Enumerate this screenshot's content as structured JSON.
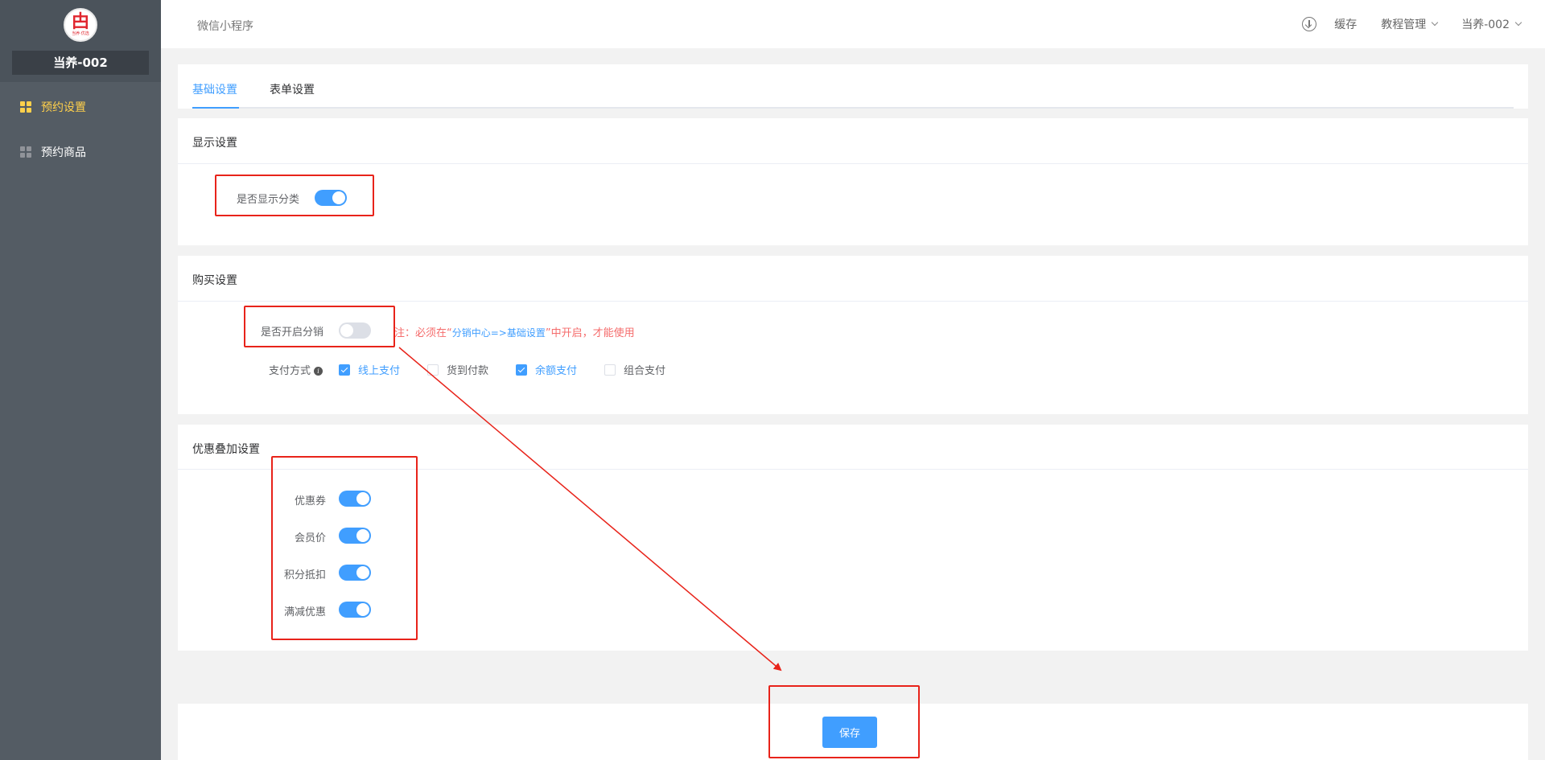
{
  "sidebar": {
    "logo_mark": "甴",
    "logo_text": "当养·优选",
    "store_name": "当养-002",
    "items": [
      {
        "label": "预约设置",
        "active": true
      },
      {
        "label": "预约商品",
        "active": false
      }
    ]
  },
  "header": {
    "breadcrumb": "微信小程序",
    "cache_label": "缓存",
    "tutorial_label": "教程管理",
    "user_label": "当养-002"
  },
  "tabs": [
    {
      "label": "基础设置",
      "active": true
    },
    {
      "label": "表单设置",
      "active": false
    }
  ],
  "display_settings": {
    "title": "显示设置",
    "show_category_label": "是否显示分类",
    "show_category_on": true
  },
  "purchase_settings": {
    "title": "购买设置",
    "distribution_label": "是否开启分销",
    "distribution_on": false,
    "note_prefix": "注：必须在“",
    "note_link": "分销中心=>基础设置",
    "note_suffix": "”中开启，才能使用",
    "payment_label": "支付方式",
    "payment_options": [
      {
        "label": "线上支付",
        "checked": true
      },
      {
        "label": "货到付款",
        "checked": false
      },
      {
        "label": "余额支付",
        "checked": true
      },
      {
        "label": "组合支付",
        "checked": false
      }
    ]
  },
  "discount_settings": {
    "title": "优惠叠加设置",
    "items": [
      {
        "label": "优惠券",
        "on": true
      },
      {
        "label": "会员价",
        "on": true
      },
      {
        "label": "积分抵扣",
        "on": true
      },
      {
        "label": "满减优惠",
        "on": true
      }
    ]
  },
  "save_label": "保存",
  "colors": {
    "sidebar_bg": "#545c64",
    "accent": "#409eff",
    "active_menu": "#ffd04b",
    "annotation": "#e8231a",
    "warning_text": "#f56c6c"
  }
}
